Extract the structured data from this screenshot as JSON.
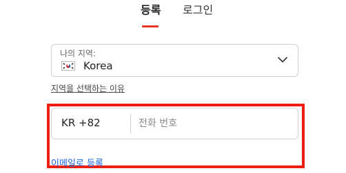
{
  "tabs": [
    {
      "label": "등록",
      "active": true
    },
    {
      "label": "로그인",
      "active": false
    }
  ],
  "accent_color": "#e4321e",
  "highlight_color": "#ee1f0c",
  "link_color": "#1a63d6",
  "region": {
    "label": "나의 지역:",
    "flag_icon": "south-korea-flag-icon",
    "value": "Korea",
    "dropdown_icon": "chevron-down-icon",
    "why_link": "지역을 선택하는 이유"
  },
  "phone": {
    "country_code": "KR +82",
    "placeholder": "전화 번호",
    "value": ""
  },
  "email_signup_link": "이메일로 등록"
}
